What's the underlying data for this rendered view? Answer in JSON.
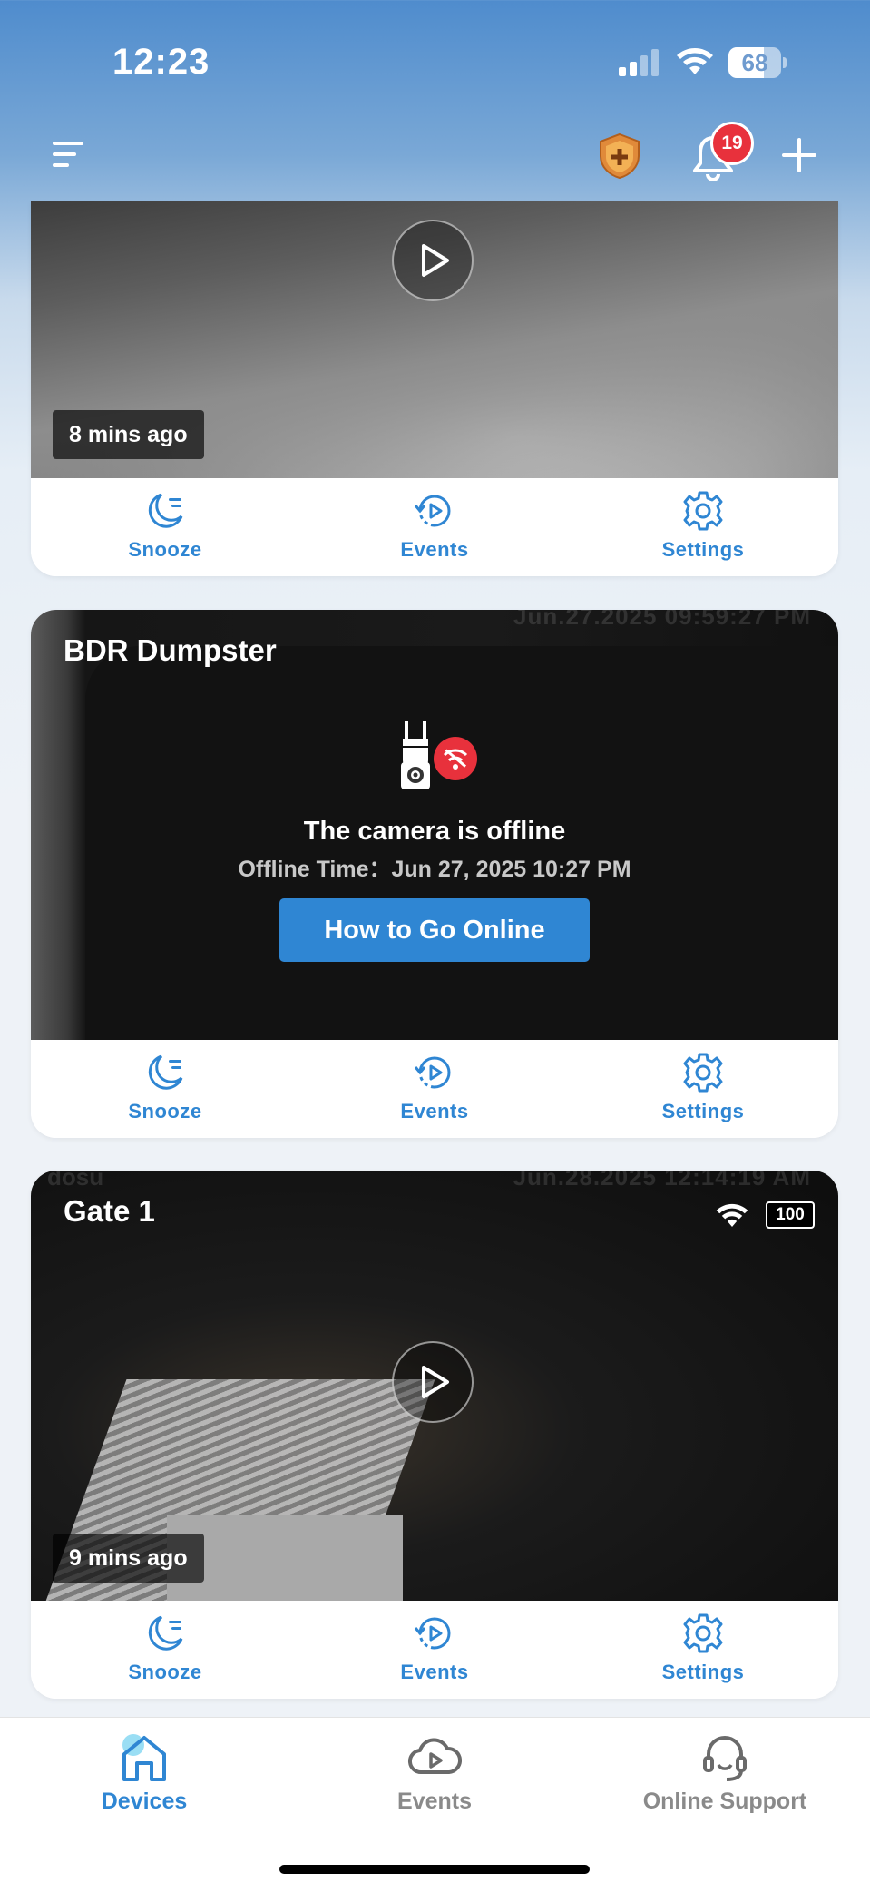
{
  "status_bar": {
    "time": "12:23",
    "battery_percent": "68",
    "battery_level": 0.68
  },
  "header": {
    "notification_count": "19"
  },
  "cards": [
    {
      "id": "camera-1",
      "title": "",
      "last_seen": "8 mins ago",
      "actions": {
        "snooze": "Snooze",
        "events": "Events",
        "settings": "Settings"
      }
    },
    {
      "id": "camera-2",
      "title": "BDR Dumpster",
      "timestamp_overlay": "Jun.27.2025 09:59:27 PM",
      "offline_title": "The camera is offline",
      "offline_time": "Offline Time：Jun 27, 2025 10:27 PM",
      "go_online_label": "How to Go Online",
      "actions": {
        "snooze": "Snooze",
        "events": "Events",
        "settings": "Settings"
      }
    },
    {
      "id": "camera-3",
      "title": "Gate 1",
      "brand_overlay": "dosu",
      "timestamp_overlay": "Jun.28.2025 12:14:19 AM",
      "battery": "100",
      "last_seen": "9 mins ago",
      "actions": {
        "snooze": "Snooze",
        "events": "Events",
        "settings": "Settings"
      }
    }
  ],
  "tab_bar": {
    "items": [
      {
        "label": "Devices",
        "icon": "home-icon",
        "active": true
      },
      {
        "label": "Events",
        "icon": "cloud-play-icon",
        "active": false
      },
      {
        "label": "Online Support",
        "icon": "headset-icon",
        "active": false
      }
    ]
  },
  "colors": {
    "accent": "#2f86d3",
    "badge": "#e8313c",
    "inactive": "#8a8a8a"
  }
}
